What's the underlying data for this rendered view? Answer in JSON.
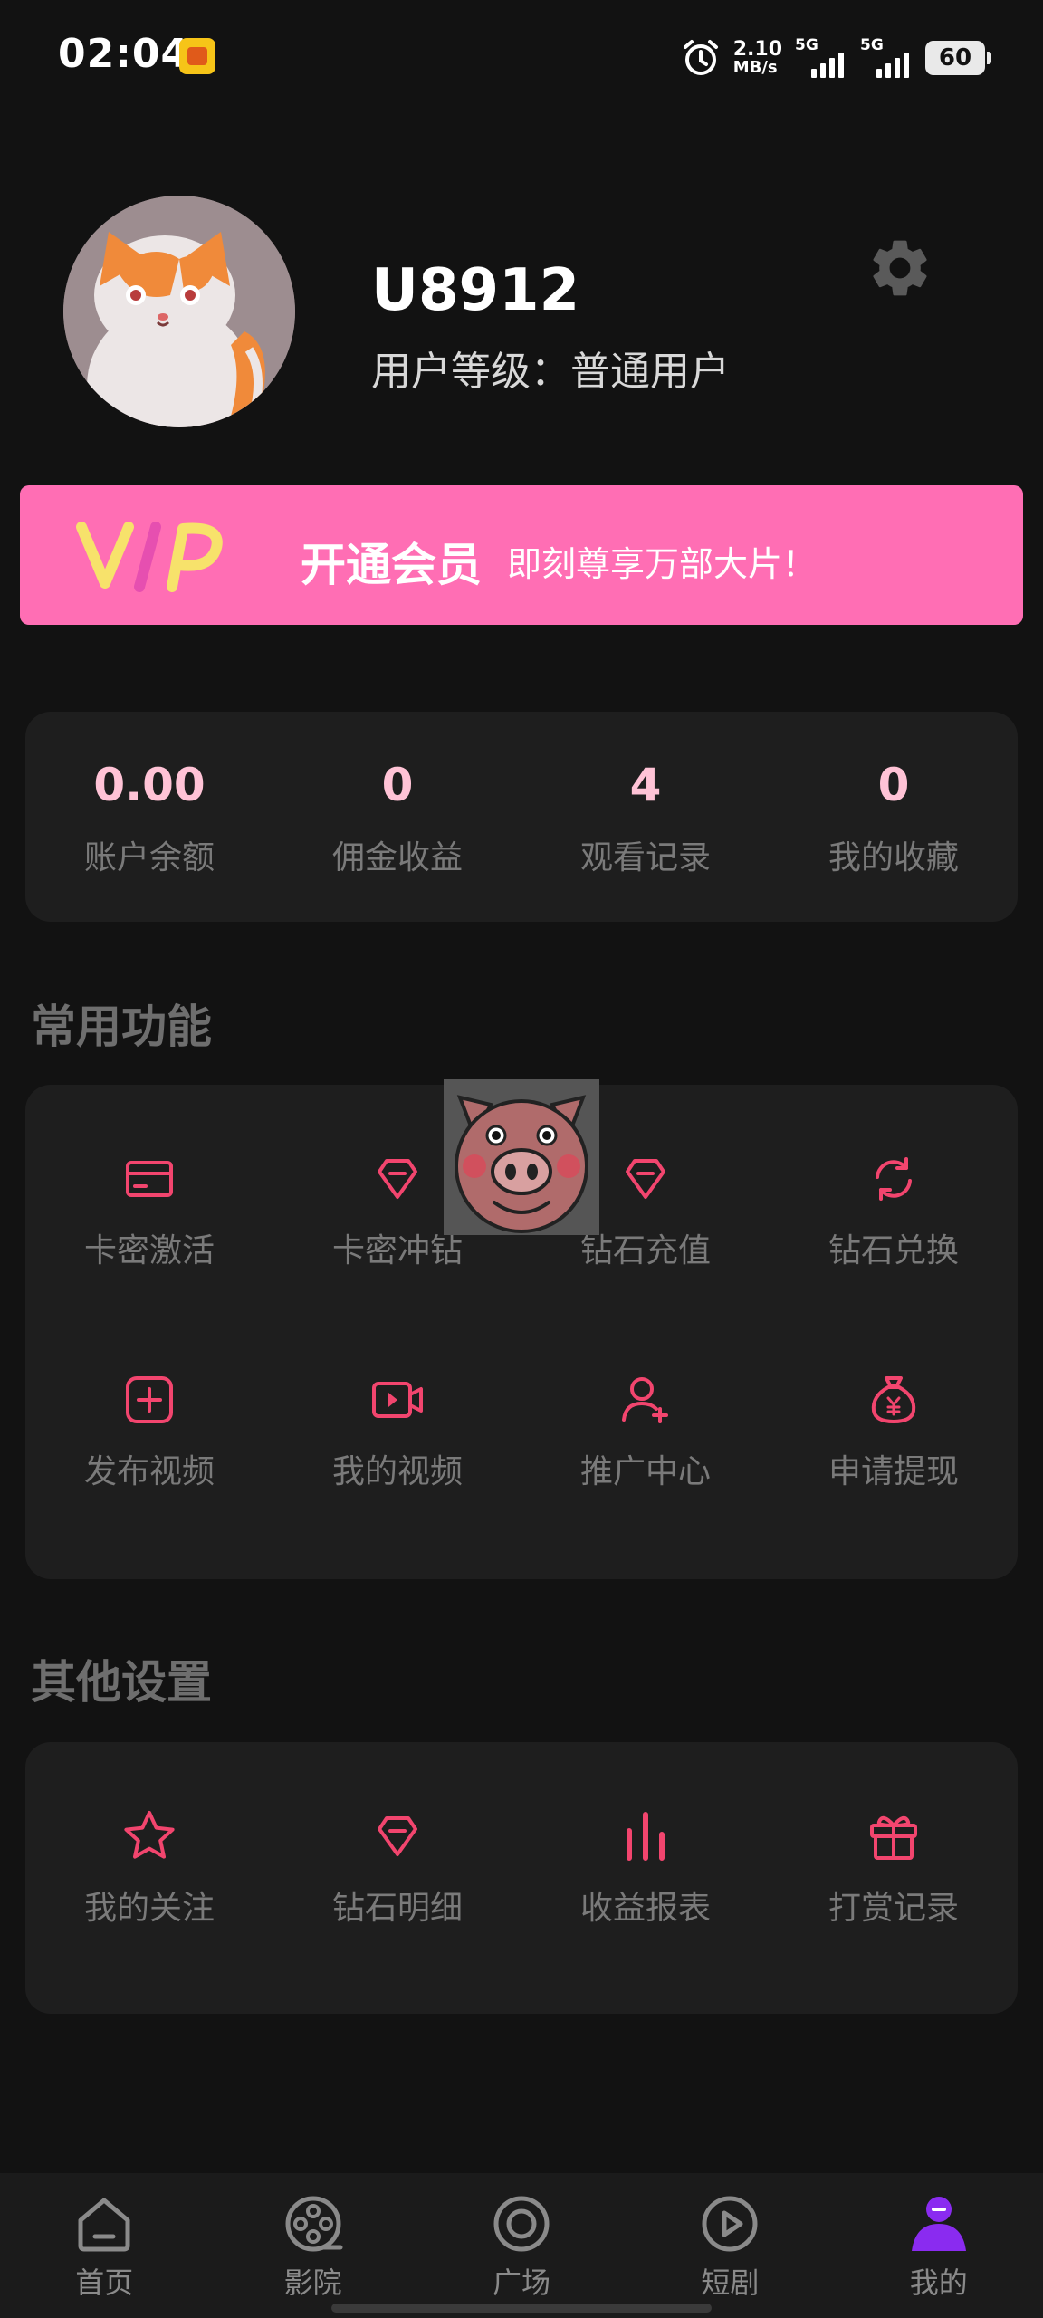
{
  "status_bar": {
    "time": "02:04",
    "net_speed_value": "2.10",
    "net_speed_unit": "MB/s",
    "sim1_label": "5G",
    "sim2_label": "5G",
    "battery": "60"
  },
  "profile": {
    "username": "U8912",
    "level_label": "用户等级：",
    "level_value": "普通用户"
  },
  "vip": {
    "logo_text": "VIP",
    "title": "开通会员",
    "subtitle": "即刻尊享万部大片！"
  },
  "stats": [
    {
      "value": "0.00",
      "label": "账户余额"
    },
    {
      "value": "0",
      "label": "佣金收益"
    },
    {
      "value": "4",
      "label": "观看记录"
    },
    {
      "value": "0",
      "label": "我的收藏"
    }
  ],
  "common": {
    "title": "常用功能",
    "items": [
      {
        "label": "卡密激活",
        "icon": "card-icon"
      },
      {
        "label": "卡密冲钻",
        "icon": "diamond-icon"
      },
      {
        "label": "钻石充值",
        "icon": "diamond-minus-icon"
      },
      {
        "label": "钻石兑换",
        "icon": "refresh-icon"
      },
      {
        "label": "发布视频",
        "icon": "add-square-icon"
      },
      {
        "label": "我的视频",
        "icon": "video-icon"
      },
      {
        "label": "推广中心",
        "icon": "add-user-icon"
      },
      {
        "label": "申请提现",
        "icon": "money-bag-icon"
      }
    ]
  },
  "other": {
    "title": "其他设置",
    "items": [
      {
        "label": "我的关注",
        "icon": "star-icon"
      },
      {
        "label": "钻石明细",
        "icon": "diamond-icon"
      },
      {
        "label": "收益报表",
        "icon": "bar-chart-icon"
      },
      {
        "label": "打赏记录",
        "icon": "gift-icon"
      }
    ]
  },
  "nav": [
    {
      "label": "首页",
      "icon": "home-icon"
    },
    {
      "label": "影院",
      "icon": "film-reel-icon"
    },
    {
      "label": "广场",
      "icon": "circle-icon"
    },
    {
      "label": "短剧",
      "icon": "play-circle-icon"
    },
    {
      "label": "我的",
      "icon": "profile-icon"
    }
  ],
  "colors": {
    "accent": "#f2456e",
    "vip_banner": "#ff6eb4",
    "stat_value": "#ffc3d6",
    "nav_active": "#8a2bf0"
  }
}
